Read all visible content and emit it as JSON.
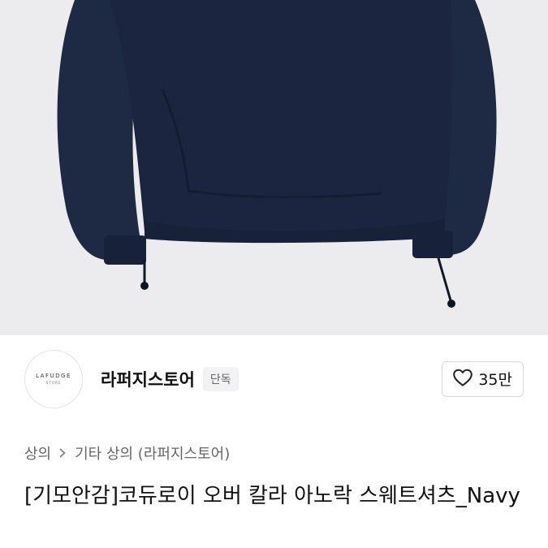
{
  "product_image": {
    "icon": "navy-sweatshirt-photo",
    "color": "#1f2a44",
    "background": "#ececee"
  },
  "store": {
    "logo_text": "LAFUDGE",
    "logo_subtext": "STORE",
    "name": "라퍼지스토어",
    "badge": "단독"
  },
  "like": {
    "icon": "heart-outline-icon",
    "count": "35만"
  },
  "breadcrumb": {
    "items": [
      "상의",
      "기타 상의 (라퍼지스토어)"
    ],
    "separator_icon": "chevron-right-icon"
  },
  "product": {
    "title": "[기모안감]코듀로이 오버 칼라 아노락 스웨트셔츠_Navy"
  }
}
